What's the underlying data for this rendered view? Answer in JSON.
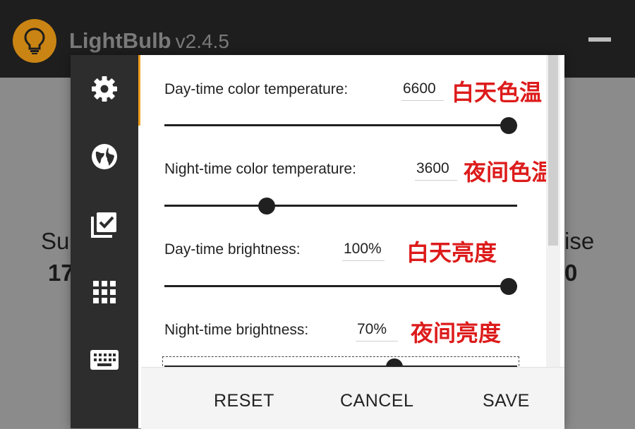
{
  "app": {
    "name": "LightBulb",
    "version": "v2.4.5",
    "icons": {
      "logo": "lightbulb-icon",
      "minimize": "minimize-icon"
    }
  },
  "background": {
    "left_label": "Su",
    "left_value": "17",
    "right_label": "ise",
    "right_value": "0"
  },
  "nav": {
    "items": [
      {
        "icon": "gear-icon",
        "active": true
      },
      {
        "icon": "globe-icon",
        "active": false
      },
      {
        "icon": "checklist-icon",
        "active": false
      },
      {
        "icon": "apps-grid-icon",
        "active": false
      },
      {
        "icon": "keyboard-icon",
        "active": false
      }
    ]
  },
  "settings": [
    {
      "label": "Day-time color temperature:",
      "value": "6600",
      "annotation": "白天色温",
      "slider_level": 1.0
    },
    {
      "label": "Night-time color temperature:",
      "value": "3600",
      "annotation": "夜间色温",
      "slider_level": 0.28
    },
    {
      "label": "Day-time brightness:",
      "value": "100%",
      "annotation": "白天亮度",
      "slider_level": 1.0
    },
    {
      "label": "Night-time brightness:",
      "value": "70%",
      "annotation": "夜间亮度",
      "slider_level": 0.66
    }
  ],
  "footer": {
    "reset_label": "RESET",
    "cancel_label": "CANCEL",
    "save_label": "SAVE"
  },
  "colors": {
    "accent": "#f0a020",
    "annotation": "#dd1b1b",
    "titlebar": "#1e1e1e",
    "nav": "#2d2d2d"
  }
}
